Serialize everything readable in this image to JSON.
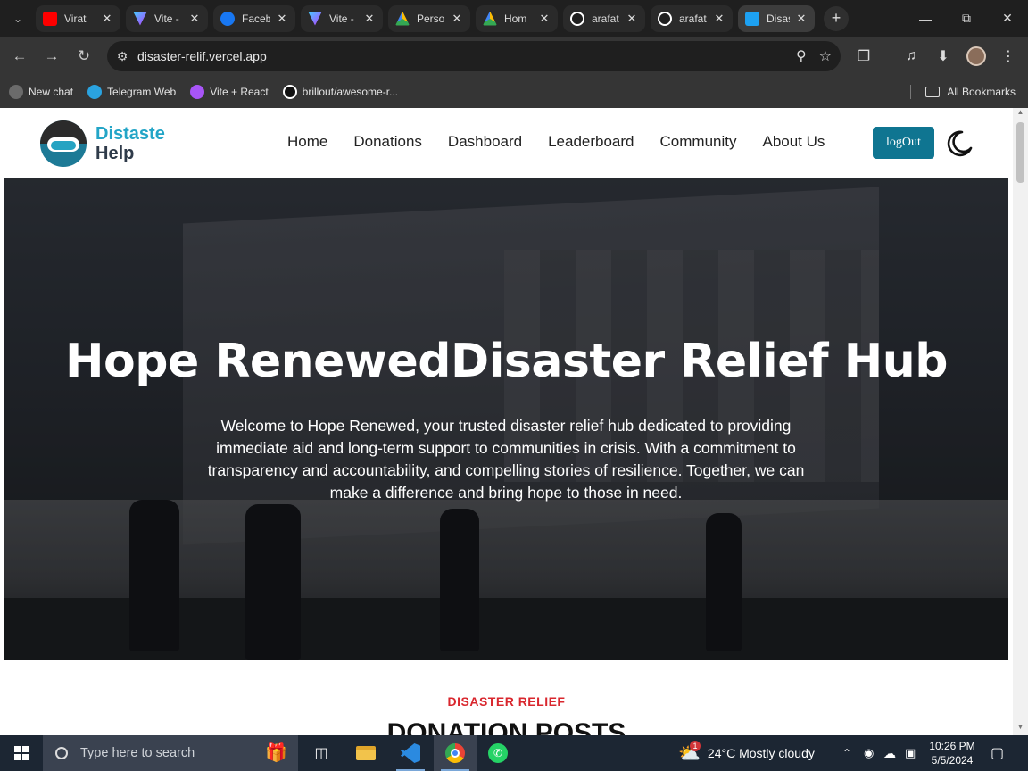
{
  "browser": {
    "tabs": [
      {
        "title": "Virat",
        "icon": "youtube-icon",
        "color": "#ff0000"
      },
      {
        "title": "Vite -",
        "icon": "vite-icon",
        "color": "#a855f7"
      },
      {
        "title": "Faceb",
        "icon": "facebook-icon",
        "color": "#1877f2"
      },
      {
        "title": "Vite -",
        "icon": "vite-icon",
        "color": "#a855f7"
      },
      {
        "title": "Perso",
        "icon": "drive-icon",
        "color": "#34a853"
      },
      {
        "title": "Hom",
        "icon": "drive-icon",
        "color": "#34a853"
      },
      {
        "title": "arafat",
        "icon": "github-icon",
        "color": "#ffffff"
      },
      {
        "title": "arafat",
        "icon": "github-icon",
        "color": "#ffffff"
      },
      {
        "title": "Disas",
        "icon": "site-icon",
        "color": "#1da1f2"
      }
    ],
    "url": "disaster-relif.vercel.app",
    "bookmarks": [
      {
        "label": "New chat",
        "icon": "chatgpt-icon"
      },
      {
        "label": "Telegram Web",
        "icon": "telegram-icon"
      },
      {
        "label": "Vite + React",
        "icon": "vite-icon"
      },
      {
        "label": "brillout/awesome-r...",
        "icon": "github-icon"
      }
    ],
    "all_bookmarks": "All Bookmarks"
  },
  "site": {
    "logo_line1": "Distaste",
    "logo_line2": "Help",
    "nav": [
      "Home",
      "Donations",
      "Dashboard",
      "Leaderboard",
      "Community",
      "About Us"
    ],
    "logout": "logOut",
    "hero": {
      "title": "Hope RenewedDisaster Relief Hub",
      "text": "Welcome to Hope Renewed, your trusted disaster relief hub dedicated to providing immediate aid and long-term support to communities in crisis. With a commitment to transparency and accountability, and compelling stories of resilience. Together, we can make a difference and bring hope to those in need."
    },
    "section_tag": "DISASTER RELIEF",
    "section_title": "DONATION POSTS"
  },
  "taskbar": {
    "search_placeholder": "Type here to search",
    "weather": "24°C  Mostly cloudy",
    "weather_badge": "1",
    "time": "10:26 PM",
    "date": "5/5/2024"
  }
}
